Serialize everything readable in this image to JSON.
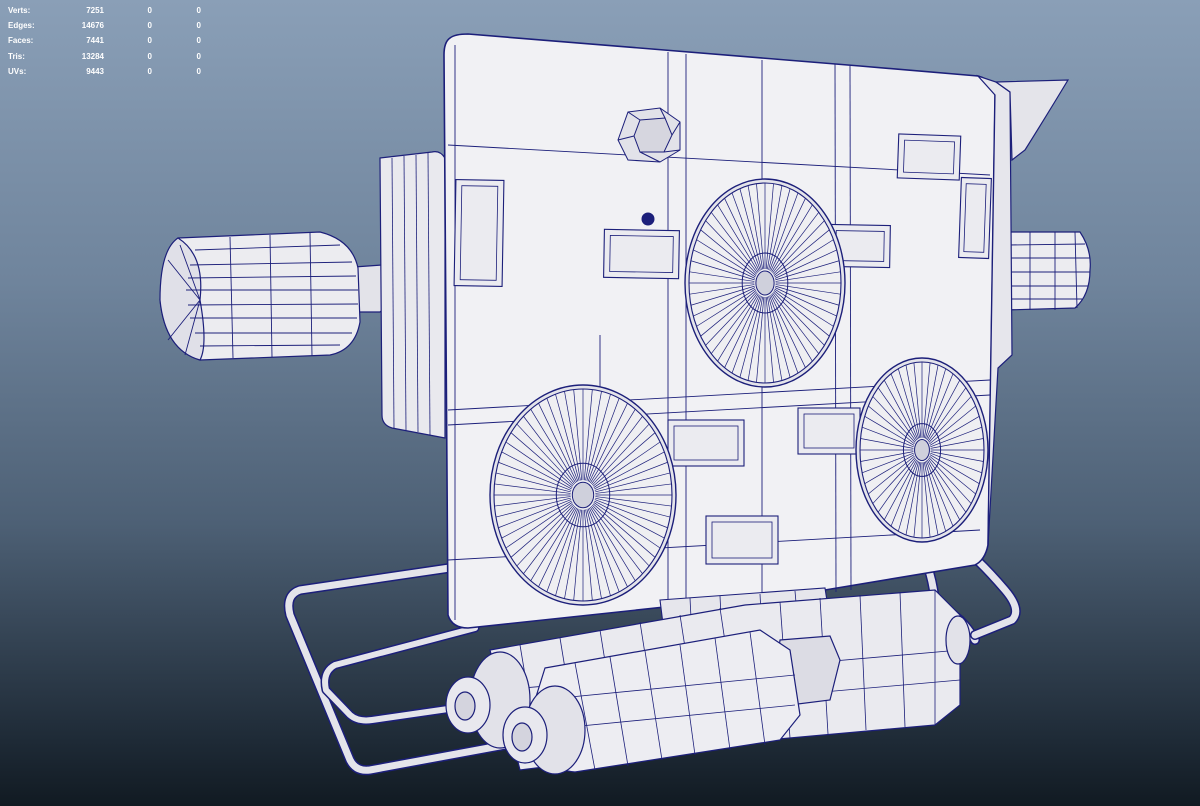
{
  "hud": {
    "rows": [
      {
        "label": "Verts:",
        "values": [
          "7251",
          "0",
          "0"
        ]
      },
      {
        "label": "Edges:",
        "values": [
          "14676",
          "0",
          "0"
        ]
      },
      {
        "label": "Faces:",
        "values": [
          "7441",
          "0",
          "0"
        ]
      },
      {
        "label": "Tris:",
        "values": [
          "13284",
          "0",
          "0"
        ]
      },
      {
        "label": "UVs:",
        "values": [
          "9443",
          "0",
          "0"
        ]
      }
    ]
  },
  "viewport": {
    "background_top": "#8a9fb7",
    "background_bottom": "#111a22",
    "mesh_fill": "#efeff2",
    "wireframe_color": "#1c1f7a"
  }
}
